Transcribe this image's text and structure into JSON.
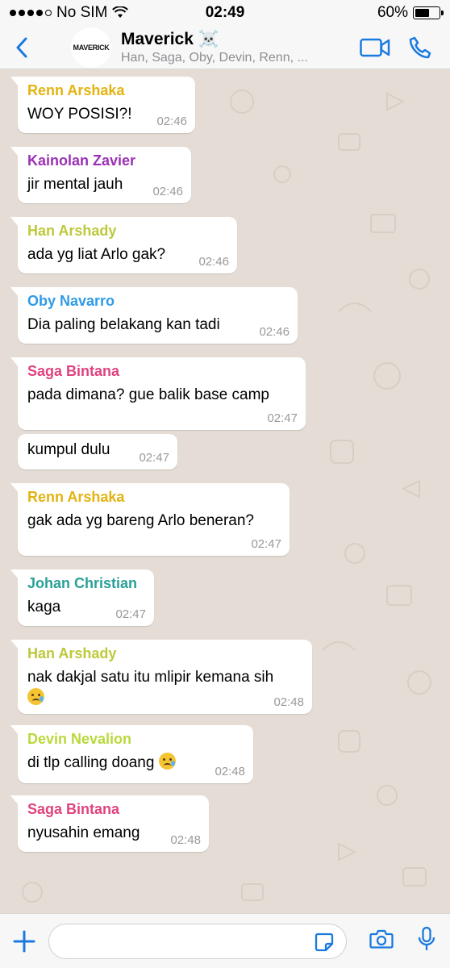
{
  "status_bar": {
    "carrier": "No SIM",
    "time": "02:49",
    "battery_percent": "60%",
    "battery_level": 0.6
  },
  "header": {
    "back_label": "",
    "avatar_text": "MAVERICK",
    "group_name": "Maverick ☠️",
    "members": "Han, Saga, Oby, Devin, Renn, ..."
  },
  "input": {
    "placeholder": ""
  },
  "colors": {
    "accent": "#1a7ae0",
    "chat_bg": "#e5ddd5",
    "bubble": "#ffffff"
  },
  "messages": [
    {
      "sender": "Renn Arshaka",
      "sender_color": "#e3b310",
      "text": "WOY POSISI?!",
      "time": "02:46"
    },
    {
      "sender": "Kainolan Zavier",
      "sender_color": "#9b30b5",
      "text": "jir mental jauh",
      "time": "02:46"
    },
    {
      "sender": "Han Arshady",
      "sender_color": "#bdc93a",
      "text": "ada yg liat Arlo gak?",
      "time": "02:46"
    },
    {
      "sender": "Oby Navarro",
      "sender_color": "#2f9be6",
      "text": "Dia paling belakang kan tadi",
      "time": "02:46"
    },
    {
      "sender": "Saga Bintana",
      "sender_color": "#e0437f",
      "text": "pada dimana? gue balik base camp",
      "time": "02:47"
    },
    {
      "sender": "",
      "sender_color": "",
      "text": "kumpul dulu",
      "time": "02:47"
    },
    {
      "sender": "Renn Arshaka",
      "sender_color": "#e3b310",
      "text": "gak ada yg bareng Arlo beneran?",
      "time": "02:47"
    },
    {
      "sender": "Johan Christian",
      "sender_color": "#2aa198",
      "text": "kaga",
      "time": "02:47"
    },
    {
      "sender": "Han Arshady",
      "sender_color": "#bdc93a",
      "text": "nak dakjal satu itu mlipir kemana sih",
      "time": "02:48"
    },
    {
      "sender": "Devin Nevalion",
      "sender_color": "#b8d93a",
      "text": "di tlp calling doang",
      "time": "02:48"
    },
    {
      "sender": "Saga Bintana",
      "sender_color": "#e0437f",
      "text": "nyusahin emang",
      "time": "02:48"
    }
  ]
}
